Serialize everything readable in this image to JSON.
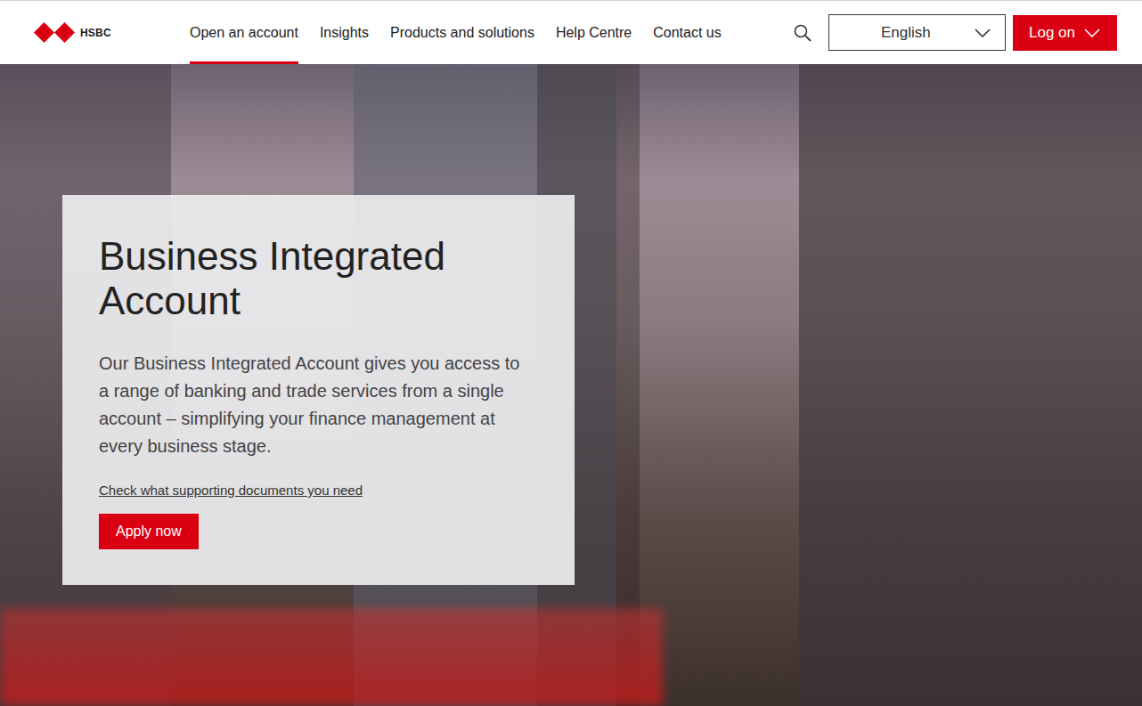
{
  "header": {
    "logo": {
      "text": "HSBC"
    },
    "nav": [
      {
        "label": "Open an account",
        "selected": true
      },
      {
        "label": "Insights",
        "selected": false
      },
      {
        "label": "Products and solutions",
        "selected": false
      },
      {
        "label": "Help Centre",
        "selected": false
      },
      {
        "label": "Contact us",
        "selected": false
      }
    ],
    "language": {
      "label": "English"
    },
    "logon": {
      "label": "Log on"
    }
  },
  "hero": {
    "title": "Business Integrated Account",
    "description": "Our Business Integrated Account gives you access to a range of banking and trade services from a single account – simplifying your finance management at every business stage.",
    "link": "Check what supporting documents you need",
    "button": "Apply now"
  }
}
